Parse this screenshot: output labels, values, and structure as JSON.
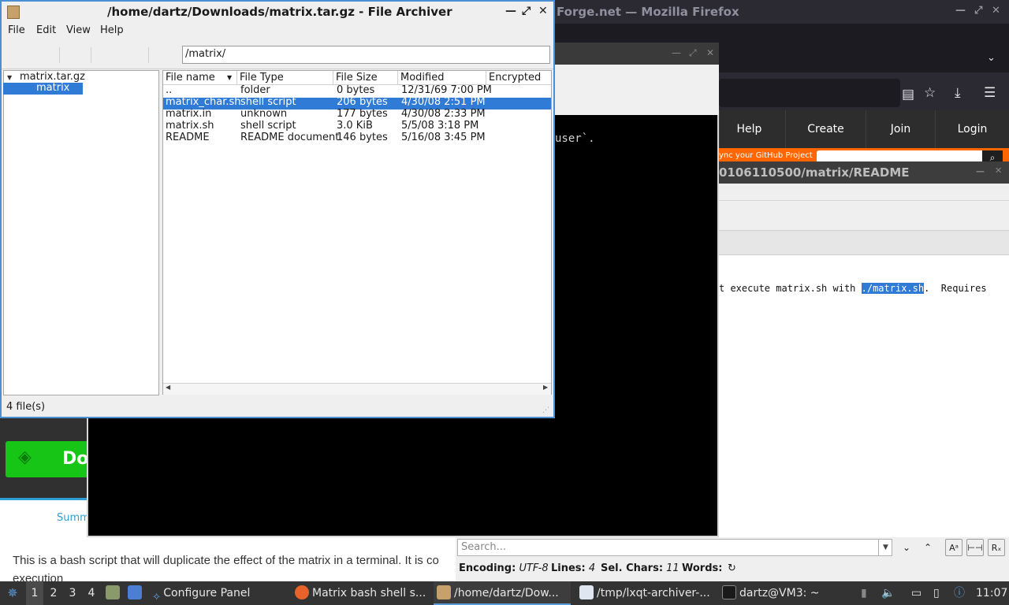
{
  "firefox": {
    "title": "Forge.net — Mozilla Firefox",
    "nav": [
      "Help",
      "Create",
      "Join",
      "Login"
    ],
    "sync_text": "ync your GitHub Project",
    "download_label": "Do",
    "summary_tab": "Summ",
    "description": "This is a bash script that will duplicate the effect of the matrix in a terminal. It is co",
    "description2": "execution"
  },
  "terminal": {
    "line": "user`."
  },
  "editor": {
    "title": "0106110500/matrix/README",
    "line_before": "t execute matrix.sh with ",
    "line_highlight": "./matrix.sh",
    "line_after": ".  Requires",
    "search_placeholder": "Search...",
    "status": {
      "encoding_label": "Encoding:",
      "encoding_value": "UTF-8",
      "lines_label": "Lines:",
      "lines_value": "4",
      "sel_label": "Sel. Chars:",
      "sel_value": "11",
      "words_label": "Words:"
    }
  },
  "archiver": {
    "title": "/home/dartz/Downloads/matrix.tar.gz - File Archiver",
    "menu": [
      "File",
      "Edit",
      "View",
      "Help"
    ],
    "path": "/matrix/",
    "tree": {
      "root": "matrix.tar.gz",
      "child": "matrix"
    },
    "columns": [
      "File name",
      "File Type",
      "File Size",
      "Modified",
      "Encrypted"
    ],
    "rows": [
      {
        "name": "..",
        "type": "folder",
        "size": "0 bytes",
        "modified": "12/31/69 7:00 PM"
      },
      {
        "name": "matrix_char.sh",
        "type": "shell script",
        "size": "206 bytes",
        "modified": "4/30/08 2:51 PM"
      },
      {
        "name": "matrix.in",
        "type": "unknown",
        "size": "177 bytes",
        "modified": "4/30/08 2:33 PM"
      },
      {
        "name": "matrix.sh",
        "type": "shell script",
        "size": "3.0 KiB",
        "modified": "5/5/08 3:18 PM"
      },
      {
        "name": "README",
        "type": "README document",
        "size": "146 bytes",
        "modified": "5/16/08 3:45 PM"
      }
    ],
    "selected_row": 1,
    "status": "4 file(s)"
  },
  "taskbar": {
    "desktops": [
      "1",
      "2",
      "3",
      "4"
    ],
    "tasks": [
      {
        "label": "Configure Panel",
        "icon": "configure-icon"
      },
      {
        "label": "Matrix bash shell s...",
        "icon": "firefox-icon"
      },
      {
        "label": "/home/dartz/Dow...",
        "icon": "archiver-icon"
      },
      {
        "label": "/tmp/lxqt-archiver-...",
        "icon": "editor-icon"
      },
      {
        "label": "dartz@VM3: ~",
        "icon": "terminal-icon"
      }
    ],
    "clock": "11:07"
  },
  "colors": {
    "selection": "#2f7bd6",
    "taskbar": "#333333",
    "sf_orange": "#ff6600",
    "sf_green": "#17c517"
  }
}
